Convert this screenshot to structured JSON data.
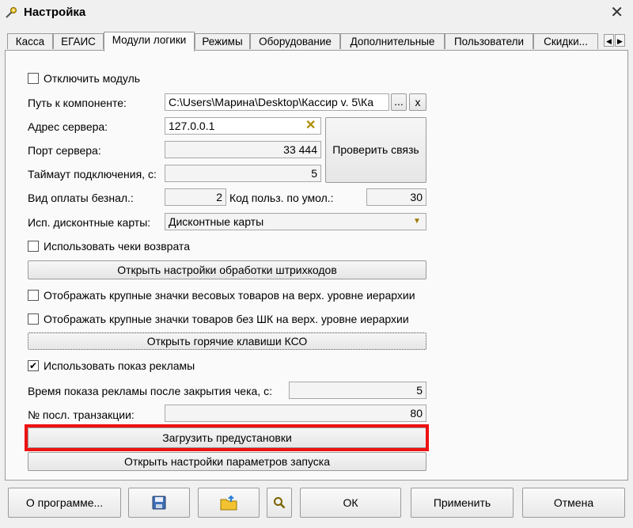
{
  "window": {
    "title": "Настройка",
    "close_icon": "close-icon"
  },
  "tabs": [
    {
      "label": "Касса"
    },
    {
      "label": "ЕГАИС"
    },
    {
      "label": "Модули логики",
      "active": true
    },
    {
      "label": "Режимы"
    },
    {
      "label": "Оборудование"
    },
    {
      "label": "Дополнительные"
    },
    {
      "label": "Пользователи"
    },
    {
      "label": "Скидки..."
    }
  ],
  "form": {
    "disable_module": {
      "label": "Отключить модуль",
      "checked": false
    },
    "component_path": {
      "label": "Путь к компоненте:",
      "value": "C:\\Users\\Марина\\Desktop\\Кассир v. 5\\Ка",
      "browse": "...",
      "clear": "x"
    },
    "server_address": {
      "label": "Адрес сервера:",
      "value": "127.0.0.1"
    },
    "server_port": {
      "label": "Порт сервера:",
      "value": "33 444"
    },
    "check_connection": "Проверить связь",
    "timeout": {
      "label": "Таймаут подключения, с:",
      "value": "5"
    },
    "payment_type": {
      "label": "Вид оплаты безнал.:",
      "value": "2"
    },
    "default_user_code": {
      "label": "Код польз. по умол.:",
      "value": "30"
    },
    "discount_cards": {
      "label": "Исп. дисконтные карты:",
      "value": "Дисконтные карты"
    },
    "use_return_receipts": {
      "label": "Использовать чеки возврата",
      "checked": false
    },
    "open_barcode_settings": "Открыть настройки обработки штрихкодов",
    "large_weight_icons": {
      "label": "Отображать крупные значки весовых товаров на верх. уровне иерархии",
      "checked": false
    },
    "large_nobarcode_icons": {
      "label": "Отображать крупные значки товаров без ШК на верх. уровне иерархии",
      "checked": false
    },
    "open_hotkeys": "Открыть горячие клавиши КСО",
    "use_ads": {
      "label": "Использовать показ рекламы",
      "checked": true
    },
    "ad_time": {
      "label": "Время показа рекламы после закрытия чека, с:",
      "value": "5"
    },
    "last_transaction": {
      "label": "№ посл. транзакции:",
      "value": "80"
    },
    "load_presets": "Загрузить предустановки",
    "open_launch_settings": "Открыть настройки параметров запуска"
  },
  "footer": {
    "about": "О программе...",
    "ok": "ОК",
    "apply": "Применить",
    "cancel": "Отмена"
  },
  "colors": {
    "highlight": "#ee1111"
  }
}
